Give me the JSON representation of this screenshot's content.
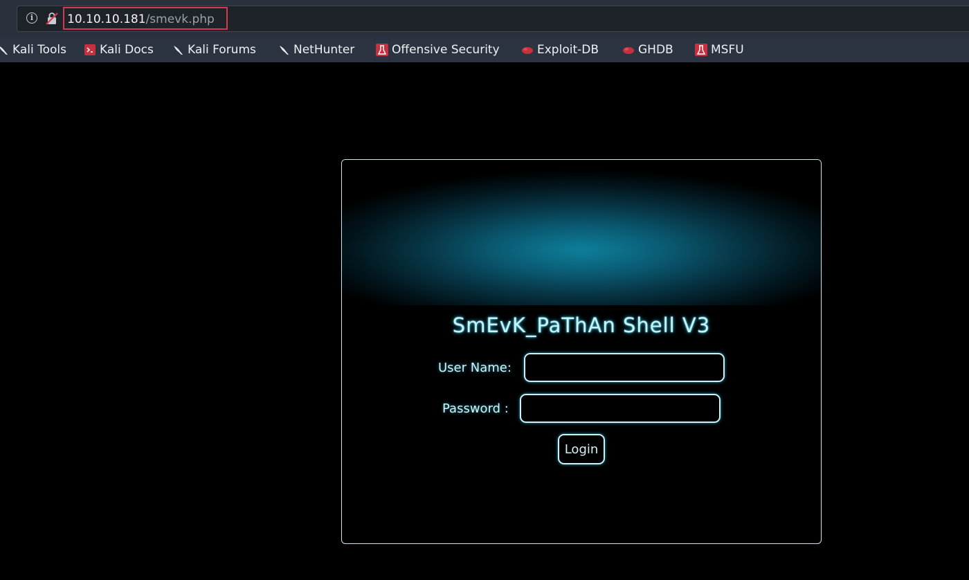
{
  "browser": {
    "url_host": "10.10.10.181",
    "url_path": "/smevk.php",
    "info_icon_glyph": "i",
    "bookmarks": [
      {
        "label": "Kali Tools",
        "icon": "kali-dragon-icon"
      },
      {
        "label": "Kali Docs",
        "icon": "kali-docs-icon"
      },
      {
        "label": "Kali Forums",
        "icon": "kali-dragon-icon"
      },
      {
        "label": "NetHunter",
        "icon": "kali-dragon-icon"
      },
      {
        "label": "Offensive Security",
        "icon": "offsec-icon"
      },
      {
        "label": "Exploit-DB",
        "icon": "exploitdb-icon"
      },
      {
        "label": "GHDB",
        "icon": "exploitdb-icon"
      },
      {
        "label": "MSFU",
        "icon": "offsec-icon"
      }
    ]
  },
  "login": {
    "title": "SmEvK_PaThAn Shell V3",
    "username_label": "User Name:",
    "password_label": "Password :",
    "username_value": "",
    "password_value": "",
    "button_label": "Login"
  },
  "colors": {
    "accent_glow": "#27b7d6",
    "url_highlight": "#d13b4d",
    "bookmark_red": "#c8303f"
  }
}
